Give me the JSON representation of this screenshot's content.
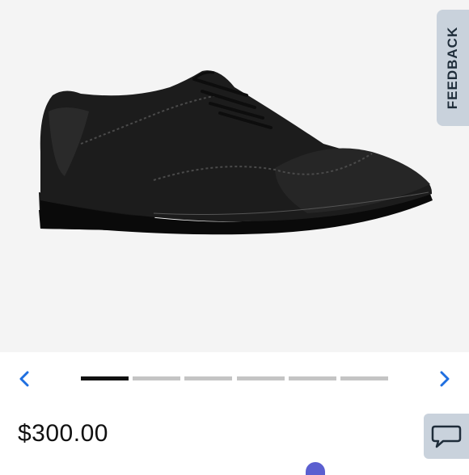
{
  "product": {
    "image_alt": "Black leather wingtip oxford shoe",
    "price": "$300.00"
  },
  "feedback": {
    "label": "FEEDBACK"
  },
  "carousel": {
    "total_slides": 6,
    "current_slide": 1,
    "prev_icon": "chevron-left-icon",
    "next_icon": "chevron-right-icon"
  },
  "chat": {
    "icon": "chat-bubble-icon"
  },
  "colors": {
    "accent_blue": "#1f6fe0",
    "tab_bg": "#c9d2dc",
    "active_dot": "#111111",
    "inactive_dot": "#c4c4c4"
  }
}
